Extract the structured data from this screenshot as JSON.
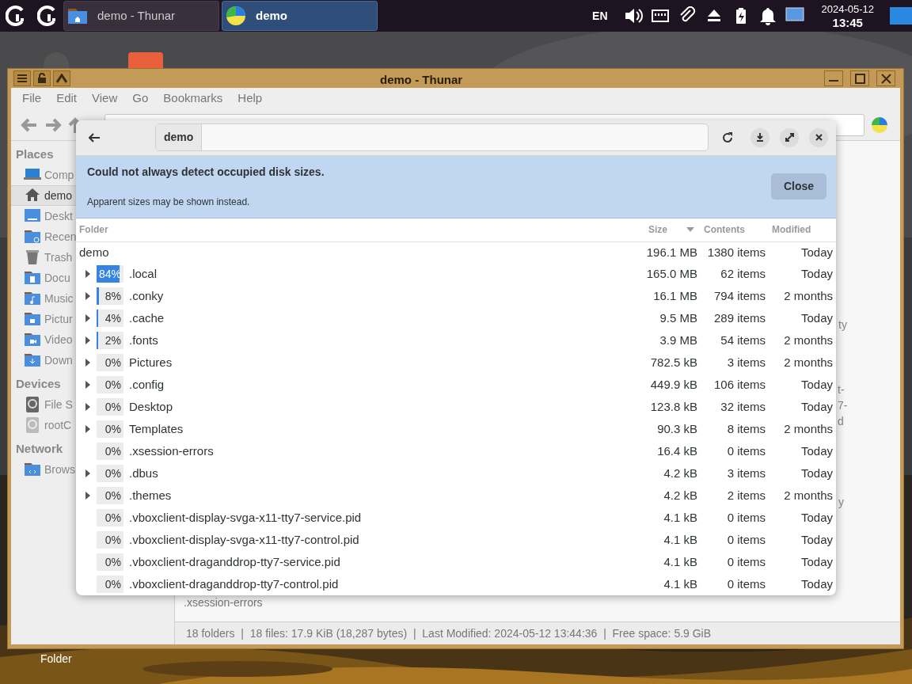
{
  "panel": {
    "taskbar": [
      {
        "title": "demo - Thunar",
        "kind": "folder",
        "selected": false
      },
      {
        "title": "demo",
        "kind": "pie",
        "selected": true
      }
    ],
    "keyboard_layout": "EN",
    "date": "2024-05-12",
    "time": "13:45"
  },
  "desktop": {
    "label": "Folder"
  },
  "thunar": {
    "title": "demo - Thunar",
    "menu": [
      "File",
      "Edit",
      "View",
      "Go",
      "Bookmarks",
      "Help"
    ],
    "sidebar": [
      {
        "heading": "Places",
        "items": [
          {
            "label": "Comp",
            "kind": "computer",
            "selected": false
          },
          {
            "label": "demo",
            "kind": "home",
            "selected": true
          },
          {
            "label": "Deskt",
            "kind": "desktop",
            "selected": false
          },
          {
            "label": "Recen",
            "kind": "recent",
            "selected": false
          },
          {
            "label": "Trash",
            "kind": "trash",
            "selected": false
          },
          {
            "label": "Docu",
            "kind": "documents",
            "selected": false
          },
          {
            "label": "Music",
            "kind": "music",
            "selected": false
          },
          {
            "label": "Pictur",
            "kind": "pictures",
            "selected": false
          },
          {
            "label": "Video",
            "kind": "videos",
            "selected": false
          },
          {
            "label": "Down",
            "kind": "downloads",
            "selected": false
          }
        ]
      },
      {
        "heading": "Devices",
        "items": [
          {
            "label": "File S",
            "kind": "drive",
            "selected": false
          },
          {
            "label": "rootC",
            "kind": "drive-off",
            "selected": false
          }
        ]
      },
      {
        "heading": "Network",
        "items": [
          {
            "label": "Brows",
            "kind": "network",
            "selected": false
          }
        ]
      }
    ],
    "partial_labels": [
      "ty",
      "t-",
      "7-",
      "d",
      "y"
    ],
    "visible_file": ".xsession-errors",
    "status_bar": "18 folders  |  18 files: 17.9 KiB (18,287 bytes)  |  Last Modified: 2024-05-12 13:44:36  |  Free space: 5.9 GiB"
  },
  "dialog": {
    "path": "demo",
    "info": {
      "title": "Could not always detect occupied disk sizes.",
      "message": "Apparent sizes may be shown instead.",
      "button": "Close"
    },
    "columns": [
      "Folder",
      "Size",
      "Contents",
      "Modified"
    ],
    "root": {
      "name": "demo",
      "size": "196.1 MB",
      "contents": "1380 items",
      "modified": "Today"
    },
    "rows": [
      {
        "percent": "84%",
        "level": 0.84,
        "name": ".local",
        "size": "165.0 MB",
        "contents": "62 items",
        "modified": "Today",
        "expandable": true
      },
      {
        "percent": "8%",
        "level": 0.08,
        "name": ".conky",
        "size": "16.1 MB",
        "contents": "794 items",
        "modified": "2 months",
        "expandable": true
      },
      {
        "percent": "4%",
        "level": 0.04,
        "name": ".cache",
        "size": "9.5 MB",
        "contents": "289 items",
        "modified": "Today",
        "expandable": true
      },
      {
        "percent": "2%",
        "level": 0.02,
        "name": ".fonts",
        "size": "3.9 MB",
        "contents": "54 items",
        "modified": "2 months",
        "expandable": true
      },
      {
        "percent": "0%",
        "level": 0,
        "name": "Pictures",
        "size": "782.5 kB",
        "contents": "3 items",
        "modified": "2 months",
        "expandable": true
      },
      {
        "percent": "0%",
        "level": 0,
        "name": ".config",
        "size": "449.9 kB",
        "contents": "106 items",
        "modified": "Today",
        "expandable": true
      },
      {
        "percent": "0%",
        "level": 0,
        "name": "Desktop",
        "size": "123.8 kB",
        "contents": "32 items",
        "modified": "Today",
        "expandable": true
      },
      {
        "percent": "0%",
        "level": 0,
        "name": "Templates",
        "size": "90.3 kB",
        "contents": "8 items",
        "modified": "2 months",
        "expandable": true
      },
      {
        "percent": "0%",
        "level": 0,
        "name": ".xsession-errors",
        "size": "16.4 kB",
        "contents": "0 items",
        "modified": "Today",
        "expandable": false
      },
      {
        "percent": "0%",
        "level": 0,
        "name": ".dbus",
        "size": "4.2 kB",
        "contents": "3 items",
        "modified": "Today",
        "expandable": true
      },
      {
        "percent": "0%",
        "level": 0,
        "name": ".themes",
        "size": "4.2 kB",
        "contents": "2 items",
        "modified": "2 months",
        "expandable": true
      },
      {
        "percent": "0%",
        "level": 0,
        "name": ".vboxclient-display-svga-x11-tty7-service.pid",
        "size": "4.1 kB",
        "contents": "0 items",
        "modified": "Today",
        "expandable": false
      },
      {
        "percent": "0%",
        "level": 0,
        "name": ".vboxclient-display-svga-x11-tty7-control.pid",
        "size": "4.1 kB",
        "contents": "0 items",
        "modified": "Today",
        "expandable": false
      },
      {
        "percent": "0%",
        "level": 0,
        "name": ".vboxclient-draganddrop-tty7-service.pid",
        "size": "4.1 kB",
        "contents": "0 items",
        "modified": "Today",
        "expandable": false
      },
      {
        "percent": "0%",
        "level": 0,
        "name": ".vboxclient-draganddrop-tty7-control.pid",
        "size": "4.1 kB",
        "contents": "0 items",
        "modified": "Today",
        "expandable": false
      }
    ]
  }
}
